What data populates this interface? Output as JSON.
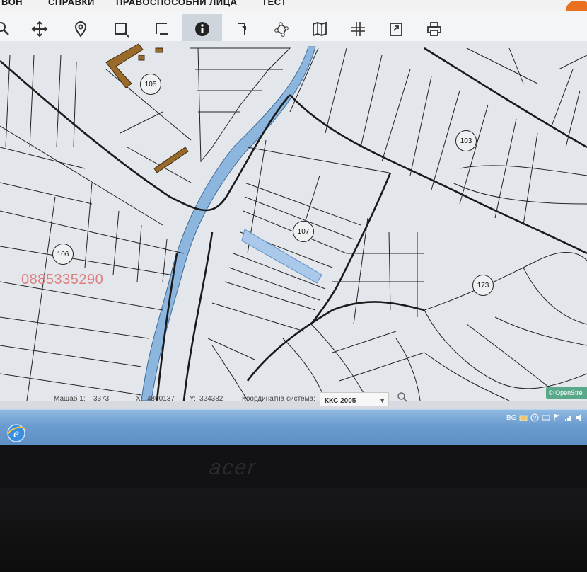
{
  "menu": {
    "items": [
      "ВОН",
      "СПРАВКИ",
      "ПРАВОСПОСОБНИ ЛИЦА",
      "ТЕСТ"
    ]
  },
  "toolbar": {
    "tools": [
      "search-icon",
      "pan-icon",
      "location-pin-icon",
      "select-rectangle-icon",
      "select-polygon-icon",
      "info-icon",
      "measure-icon",
      "polygon-draw-icon",
      "map-layers-icon",
      "crosshair-icon",
      "export-icon",
      "print-icon"
    ],
    "active_tool": "info-icon"
  },
  "map": {
    "parcel_labels": [
      "105",
      "103",
      "107",
      "106",
      "173"
    ],
    "watermark": "0885335290",
    "attribution": "© OpenStre",
    "highlight_color": "#a9c8ea",
    "water_color": "#8db6df",
    "building_color": "#9a6a2a"
  },
  "status": {
    "scale_label": "Мащаб 1:",
    "scale_value": "3373",
    "x_label": "X:",
    "x_value": "4800137",
    "y_label": "Y:",
    "y_value": "324382",
    "crs_label": "Координатна система:",
    "crs_value": "ККС 2005"
  },
  "taskbar": {
    "language": "BG"
  },
  "bezel": {
    "brand": "acer"
  }
}
